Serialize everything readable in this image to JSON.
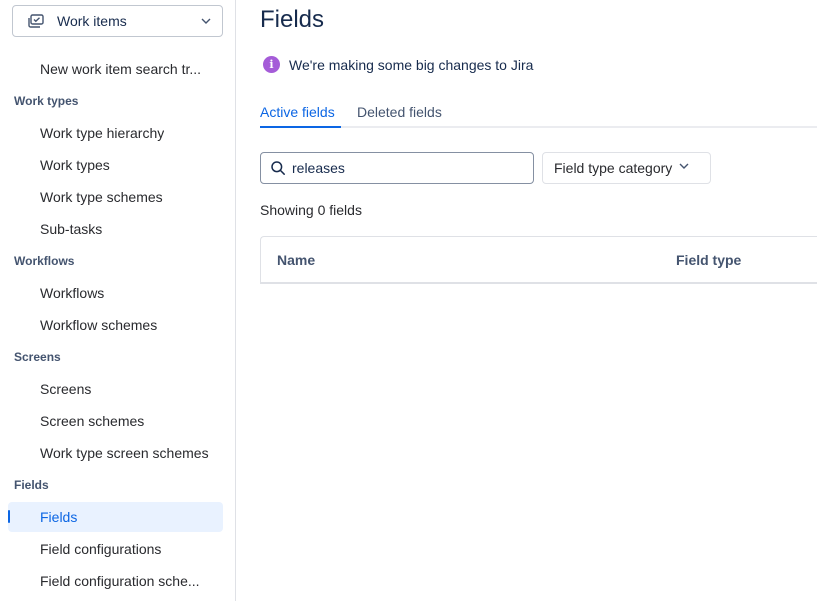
{
  "sidebar": {
    "scope_select": {
      "label": "Work items",
      "icon": "work-items-icon"
    },
    "top_item": "New work item search tr...",
    "sections": {
      "work_types": {
        "label": "Work types",
        "items": [
          "Work type hierarchy",
          "Work types",
          "Work type schemes",
          "Sub-tasks"
        ]
      },
      "workflows": {
        "label": "Workflows",
        "items": [
          "Workflows",
          "Workflow schemes"
        ]
      },
      "screens": {
        "label": "Screens",
        "items": [
          "Screens",
          "Screen schemes",
          "Work type screen schemes"
        ]
      },
      "fields": {
        "label": "Fields",
        "items": [
          "Fields",
          "Field configurations",
          "Field configuration sche..."
        ],
        "active_item": "Fields"
      }
    }
  },
  "main": {
    "title": "Fields",
    "banner": {
      "text": "We're making some big changes to Jira",
      "icon": "info-icon"
    },
    "tabs": [
      {
        "label": "Active fields",
        "active": true
      },
      {
        "label": "Deleted fields",
        "active": false
      }
    ],
    "search": {
      "value": "releases",
      "placeholder": ""
    },
    "filter": {
      "label": "Field type category"
    },
    "result_count": "Showing 0 fields",
    "table": {
      "columns": [
        "Name",
        "Field type"
      ]
    }
  },
  "colors": {
    "accent": "#0c66e4",
    "active_bg": "#e9f2ff",
    "info_purple": "#a55cd8",
    "border": "#dfe1e6"
  }
}
